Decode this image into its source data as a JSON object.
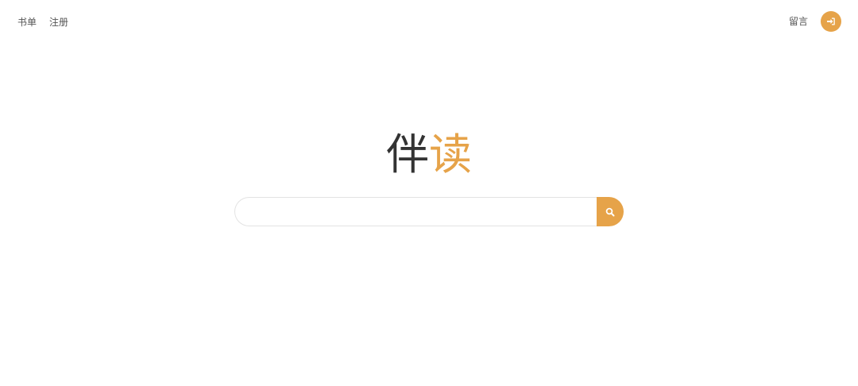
{
  "nav": {
    "booklist_label": "书单",
    "register_label": "注册",
    "guestbook_label": "留言"
  },
  "icons": {
    "login": "sign-in-icon",
    "search": "search-icon"
  },
  "logo": {
    "part1": "伴",
    "part2": "读"
  },
  "search": {
    "value": "",
    "placeholder": ""
  },
  "colors": {
    "accent": "#e6a349",
    "text": "#333333",
    "nav_text": "#555555",
    "border": "#e3e3e3"
  }
}
